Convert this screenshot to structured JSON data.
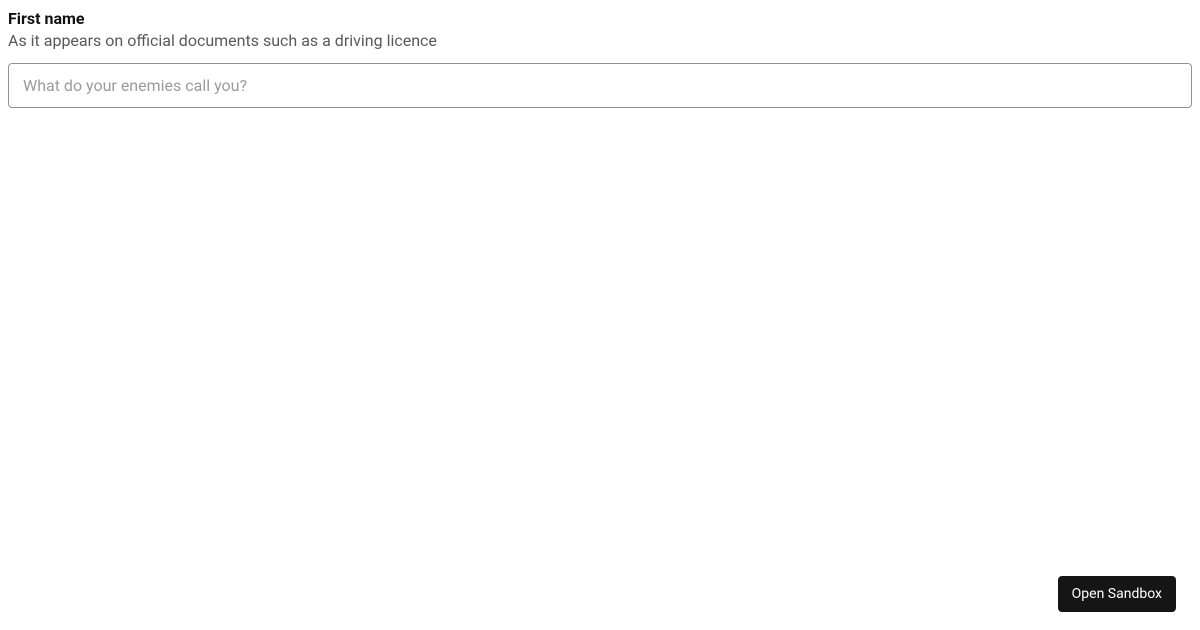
{
  "form": {
    "first_name": {
      "label": "First name",
      "hint": "As it appears on official documents such as a driving licence",
      "placeholder": "What do your enemies call you?",
      "value": ""
    }
  },
  "footer": {
    "open_sandbox_label": "Open Sandbox"
  }
}
